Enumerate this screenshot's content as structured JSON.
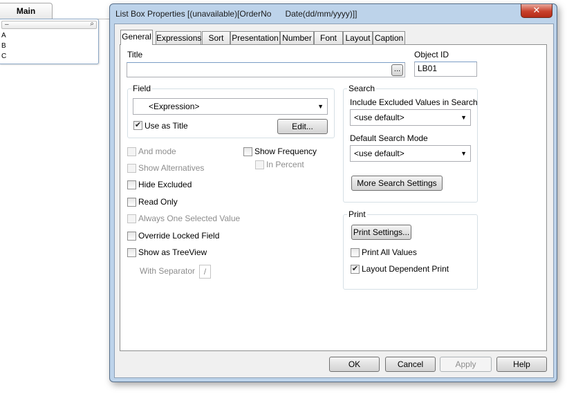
{
  "sheet": {
    "tab_label": "Main",
    "listbox": {
      "search_placeholder": "–",
      "items": [
        "A",
        "B",
        "C"
      ]
    }
  },
  "dialog": {
    "title": "List Box Properties [(unavailable)[OrderNo      Date(dd/mm/yyyy)]]",
    "close_glyph": "✕",
    "tabs": [
      {
        "label": "General",
        "active": true
      },
      {
        "label": "Expressions"
      },
      {
        "label": "Sort"
      },
      {
        "label": "Presentation"
      },
      {
        "label": "Number"
      },
      {
        "label": "Font"
      },
      {
        "label": "Layout"
      },
      {
        "label": "Caption"
      }
    ],
    "general": {
      "title_label": "Title",
      "title_value": "",
      "title_browse": "...",
      "object_id_label": "Object ID",
      "object_id_value": "LB01",
      "field_group": "Field",
      "field_value": "<Expression>",
      "use_as_title": {
        "label": "Use as Title",
        "checked": true
      },
      "edit_button": "Edit...",
      "and_mode": {
        "label": "And mode",
        "checked": false,
        "enabled": false
      },
      "show_alternatives": {
        "label": "Show Alternatives",
        "checked": false,
        "enabled": false
      },
      "hide_excluded": {
        "label": "Hide Excluded",
        "checked": false
      },
      "read_only": {
        "label": "Read Only",
        "checked": false
      },
      "always_one_selected": {
        "label": "Always One Selected Value",
        "checked": false,
        "enabled": false
      },
      "override_locked": {
        "label": "Override Locked Field",
        "checked": false
      },
      "show_as_treeview": {
        "label": "Show as TreeView",
        "checked": false
      },
      "with_separator_label": "With Separator",
      "separator_value": "/",
      "show_frequency": {
        "label": "Show Frequency",
        "checked": false
      },
      "in_percent": {
        "label": "In Percent",
        "checked": false,
        "enabled": false
      },
      "search_group": "Search",
      "include_excluded_label": "Include Excluded Values in Search",
      "include_excluded_value": "<use default>",
      "default_search_mode_label": "Default Search Mode",
      "default_search_mode_value": "<use default>",
      "more_search_button": "More Search Settings",
      "print_group": "Print",
      "print_settings_button": "Print Settings...",
      "print_all_values": {
        "label": "Print All Values",
        "checked": false
      },
      "layout_dependent_print": {
        "label": "Layout Dependent Print",
        "checked": true
      }
    },
    "buttons": {
      "ok": "OK",
      "cancel": "Cancel",
      "apply": "Apply",
      "help": "Help"
    },
    "check_glyph": "✔",
    "dropdown_glyph": "▼",
    "search_icon_glyph": "⌕"
  }
}
